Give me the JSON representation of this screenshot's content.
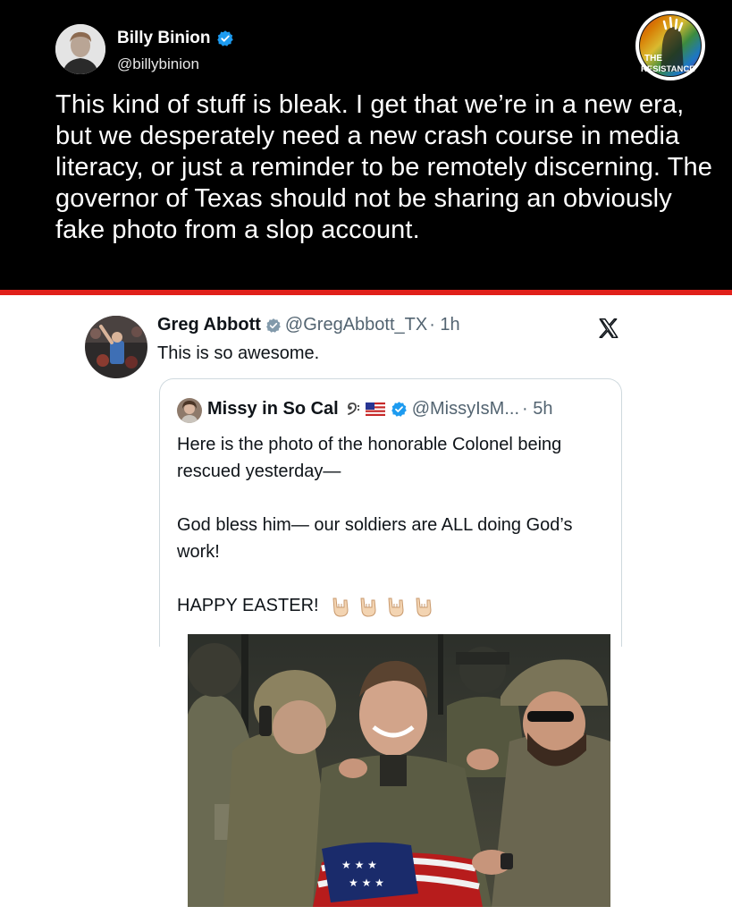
{
  "main_post": {
    "author_name": "Billy Binion",
    "author_handle": "@billybinion",
    "verified": true,
    "text": "This kind of stuff is bleak. I get that we’re in a new era, but we desperately need a new crash course in media literacy, or just a reminder to be remotely discerning. The governor of Texas should not be sharing an obviously fake photo from a slop account."
  },
  "watermark": {
    "line1": "THE",
    "line2": "RESISTANCE"
  },
  "embedded_post": {
    "author_name": "Greg Abbott",
    "author_handle": "@GregAbbott_TX",
    "time": "· 1h",
    "text": "This is so awesome.",
    "platform_icon": "x-logo-icon"
  },
  "quoted_post": {
    "author_name": "Missy in So Cal",
    "name_emojis": [
      "music-clef-icon",
      "us-flag-icon"
    ],
    "author_handle": "@MissyIsM...",
    "time": "· 5h",
    "paragraph1": "Here is the photo of the honorable Colonel being rescued yesterday—",
    "paragraph2": "God bless him— our soldiers are ALL doing God’s work!",
    "paragraph3": "HAPPY EASTER!",
    "trailing_emojis": [
      "love-you-hand-icon",
      "love-you-hand-icon",
      "love-you-hand-icon",
      "love-you-hand-icon"
    ]
  },
  "colors": {
    "top_background": "#000000",
    "divider": "#e0201a",
    "verified_blue": "#1d9bf0",
    "gold_verified": "#829aab",
    "muted_text": "#536471"
  }
}
